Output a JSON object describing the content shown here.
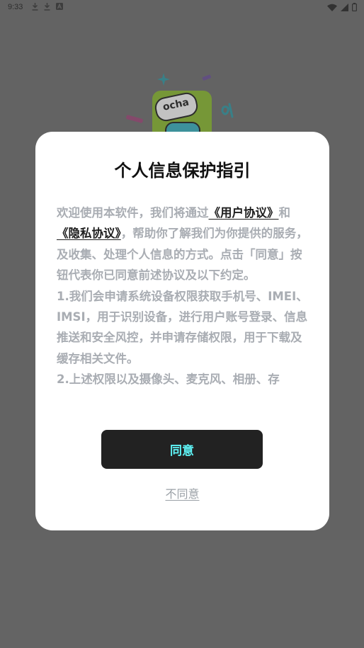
{
  "status_bar": {
    "time": "9:33",
    "left_icons": [
      "download-icon",
      "download-icon",
      "a-icon"
    ],
    "right_icons": [
      "wifi-icon",
      "signal-icon",
      "battery-icon"
    ]
  },
  "background": {
    "logo_text": "ocha"
  },
  "dialog": {
    "title": "个人信息保护指引",
    "body": {
      "intro_before": "欢迎使用本软件，我们将通过",
      "link_user_agreement": "《用户协议》",
      "and": "和",
      "link_privacy_agreement": "《隐私协议》",
      "intro_after": "，帮助你了解我们为你提供的服务，及收集、处理个人信息的方式。点击「同意」按钮代表你已同意前述协议及以下约定。",
      "item1": "1.我们会申请系统设备权限获取手机号、IMEI、IMSI，用于识别设备，进行用户账号登录、信息推送和安全风控，并申请存储权限，用于下载及缓存相关文件。",
      "item2": "2.上述权限以及摄像头、麦克风、相册、存"
    },
    "agree_label": "同意",
    "disagree_label": "不同意"
  },
  "colors": {
    "title_highlight": "#6ff2f6",
    "agree_button_bg": "#222222",
    "agree_button_text": "#5ff5f8",
    "body_text": "#a9adb3",
    "link_text": "#1e1e1e"
  }
}
